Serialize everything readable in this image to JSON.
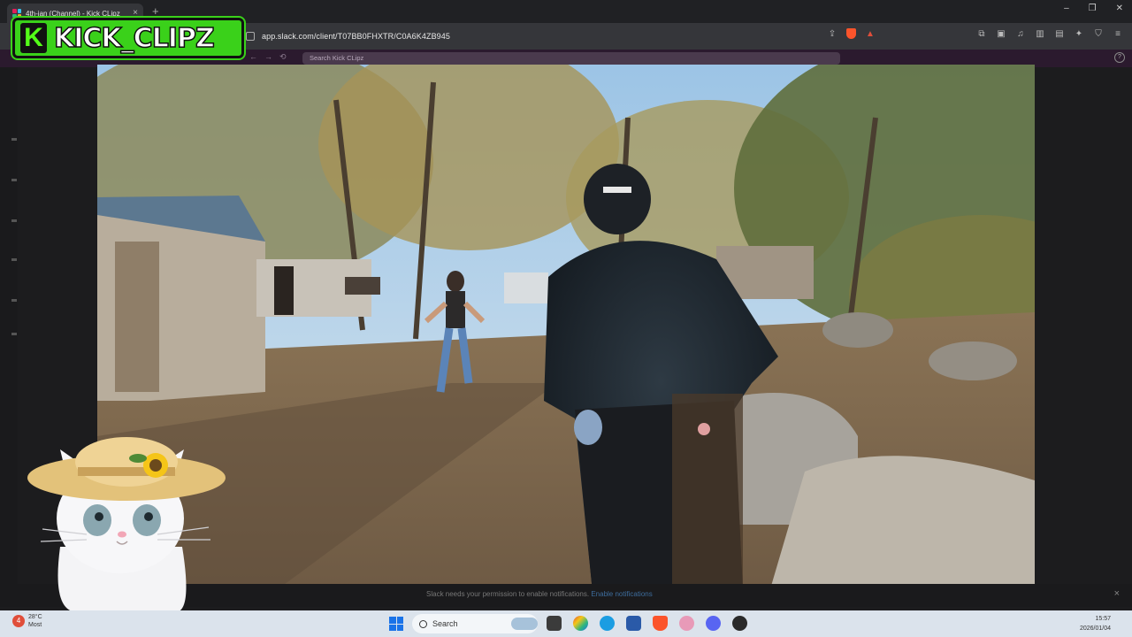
{
  "browser": {
    "tab_title": "4th-jan (Channel) - Kick CLipz",
    "tab_close": "×",
    "new_tab": "+",
    "url": "app.slack.com/client/T07BB0FHXTR/C0A6K4ZB945",
    "window_minimize": "–",
    "window_restore": "❐",
    "window_close": "✕"
  },
  "slack": {
    "search_placeholder": "Search Kick CLipz",
    "notification": "Slack needs your permission to enable notifications.",
    "notification_link": "Enable notifications",
    "notification_close": "×",
    "help": "?"
  },
  "overlay": {
    "logo_mark": "K",
    "logo_text": "KICK_CLIPZ"
  },
  "taskbar": {
    "weather_temp": "28°C",
    "weather_desc": "Most",
    "weather_badge": "4",
    "search_label": "Search",
    "time": "15:57",
    "date": "2026/01/04"
  },
  "colors": {
    "kick_green": "#53fc18",
    "slack_aubergine": "#2b1a2e",
    "taskbar": "#dbe3ec"
  }
}
